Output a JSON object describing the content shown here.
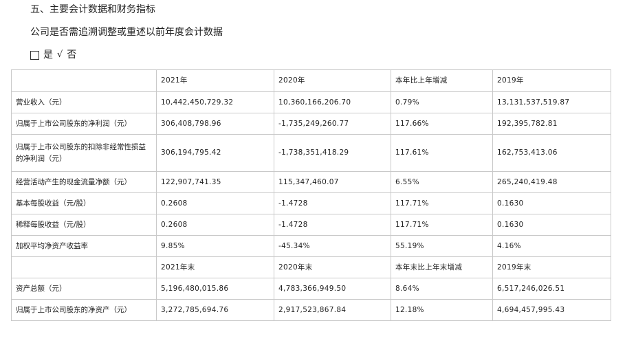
{
  "heading": "五、主要会计数据和财务指标",
  "question": "公司是否需追溯调整或重述以前年度会计数据",
  "options": {
    "yes_label": "是",
    "checkmark": "√",
    "no_label": "否"
  },
  "table": {
    "header1": [
      "",
      "2021年",
      "2020年",
      "本年比上年增减",
      "2019年"
    ],
    "section1_rows": [
      [
        "营业收入（元）",
        "10,442,450,729.32",
        "10,360,166,206.70",
        "0.79%",
        "13,131,537,519.87"
      ],
      [
        "归属于上市公司股东的净利润（元）",
        "306,408,798.96",
        "-1,735,249,260.77",
        "117.66%",
        "192,395,782.81"
      ],
      [
        "归属于上市公司股东的扣除非经常性损益的净利润（元）",
        "306,194,795.42",
        "-1,738,351,418.29",
        "117.61%",
        "162,753,413.06"
      ],
      [
        "经营活动产生的现金流量净额（元）",
        "122,907,741.35",
        "115,347,460.07",
        "6.55%",
        "265,240,419.48"
      ],
      [
        "基本每股收益（元/股）",
        "0.2608",
        "-1.4728",
        "117.71%",
        "0.1630"
      ],
      [
        "稀释每股收益（元/股）",
        "0.2608",
        "-1.4728",
        "117.71%",
        "0.1630"
      ],
      [
        "加权平均净资产收益率",
        "9.85%",
        "-45.34%",
        "55.19%",
        "4.16%"
      ]
    ],
    "header2": [
      "",
      "2021年末",
      "2020年末",
      "本年末比上年末增减",
      "2019年末"
    ],
    "section2_rows": [
      [
        "资产总额（元）",
        "5,196,480,015.86",
        "4,783,366,949.50",
        "8.64%",
        "6,517,246,026.51"
      ],
      [
        "归属于上市公司股东的净资产（元）",
        "3,272,785,694.76",
        "2,917,523,867.84",
        "12.18%",
        "4,694,457,995.43"
      ]
    ]
  }
}
